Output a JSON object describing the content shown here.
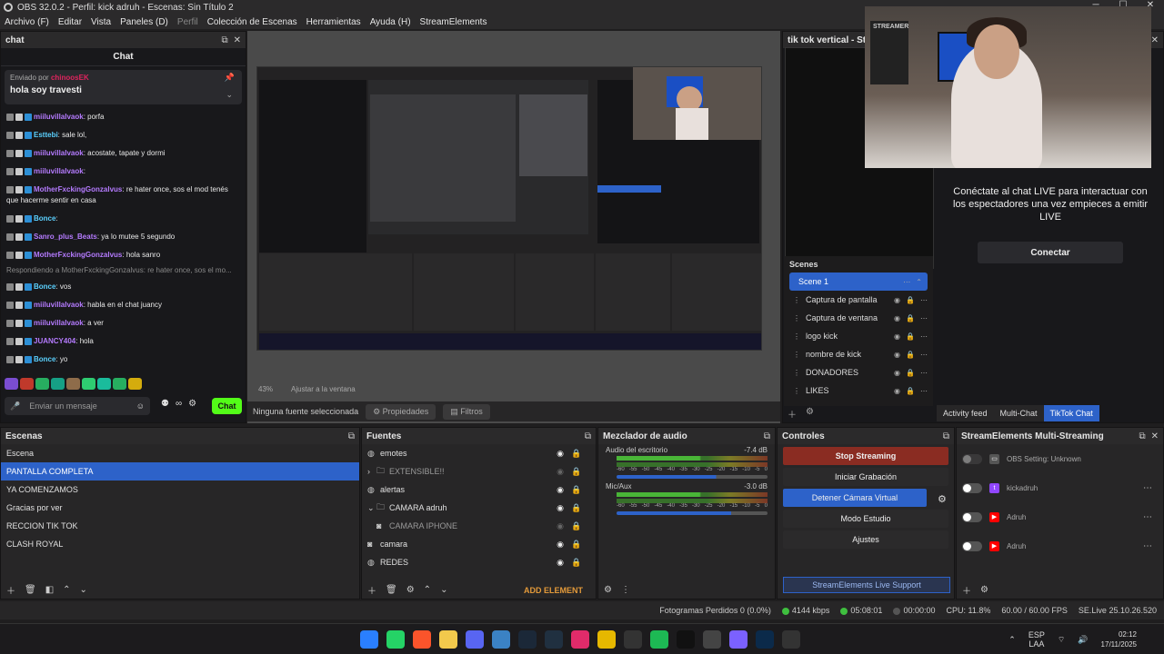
{
  "window": {
    "title": "OBS 32.0.2 - Perfil: kick adruh - Escenas: Sin Título 2"
  },
  "menu": [
    "Archivo (F)",
    "Editar",
    "Vista",
    "Paneles (D)",
    "Perfil",
    "Colección de Escenas",
    "Herramientas",
    "Ayuda (H)",
    "StreamElements"
  ],
  "chat": {
    "dock_title": "chat",
    "header": "Chat",
    "pinned_label": "Enviado por",
    "pinned_user": "chinoosEK",
    "pinned_message": "hola soy travesti",
    "messages": [
      {
        "user": "miiluvillalvaok",
        "text": "porfa",
        "color": "#b57bff"
      },
      {
        "user": "Esttebi",
        "text": "sale lol,",
        "color": "#5bd1ff"
      },
      {
        "user": "miiluvillalvaok",
        "text": "acostate, tapate y dormi",
        "color": "#b57bff"
      },
      {
        "user": "miiluvillalvaok",
        "text": "",
        "color": "#b57bff"
      },
      {
        "user": "MotherFxckingGonzalvus",
        "text": "re hater once, sos el mod tenés que hacerme sentir en casa",
        "color": "#b57bff"
      },
      {
        "user": "Bonce",
        "text": "",
        "color": "#5bd1ff"
      },
      {
        "user": "Sanro_plus_Beats",
        "text": "ya lo mutee 5 segundo",
        "color": "#b57bff"
      },
      {
        "user": "MotherFxckingGonzalvus",
        "text": "hola sanro",
        "color": "#b57bff"
      },
      {
        "user": "Bonce",
        "text": "vos",
        "color": "#5bd1ff",
        "reply": "Respondiendo a MotherFxckingGonzalvus: re hater once, sos el mo..."
      },
      {
        "user": "miiluvillalvaok",
        "text": "habla en el chat juancy",
        "color": "#b57bff"
      },
      {
        "user": "miiluvillalvaok",
        "text": "a ver",
        "color": "#b57bff"
      },
      {
        "user": "JUANCY404",
        "text": "hola",
        "color": "#b57bff"
      },
      {
        "user": "Bonce",
        "text": "yo",
        "color": "#5bd1ff"
      }
    ],
    "input_placeholder": "Enviar un mensaje",
    "send_label": "Chat"
  },
  "preview": {
    "zoom": "43%",
    "fit_label": "Ajustar a la ventana"
  },
  "propbar": {
    "no_source": "Ninguna fuente seleccionada",
    "properties": "Propiedades",
    "filters": "Filtros"
  },
  "tiktok": {
    "title": "tik tok vertical - Stre",
    "message": "Conéctate al chat LIVE para interactuar con los espectadores una vez empieces a emitir LIVE",
    "connect": "Conectar",
    "scenes_label": "Scenes",
    "scenes": [
      "Scene 1"
    ],
    "sources": [
      "Captura de pantalla",
      "Captura de ventana",
      "logo kick",
      "nombre de kick",
      "DONADORES",
      "LIKES"
    ],
    "tabs": [
      "Activity feed",
      "Multi-Chat",
      "TikTok Chat"
    ],
    "active_tab": "TikTok Chat"
  },
  "scenes": {
    "title": "Escenas",
    "items": [
      "Escena",
      "PANTALLA COMPLETA",
      "YA COMENZAMOS",
      "Gracias por ver",
      "RECCION TIK TOK",
      "CLASH ROYAL"
    ],
    "selected": "PANTALLA COMPLETA"
  },
  "sources": {
    "title": "Fuentes",
    "items": [
      {
        "name": "emotes",
        "icon": "globe-icon",
        "dim": false
      },
      {
        "name": "EXTENSIBLE!!",
        "icon": "folder-icon",
        "dim": true
      },
      {
        "name": "alertas",
        "icon": "globe-icon",
        "dim": false
      },
      {
        "name": "CAMARA adruh",
        "icon": "folder-icon",
        "dim": false
      },
      {
        "name": "CAMARA IPHONE",
        "icon": "camera-icon",
        "dim": true
      },
      {
        "name": "camara",
        "icon": "camera-icon",
        "dim": false
      },
      {
        "name": "REDES",
        "icon": "globe-icon",
        "dim": false
      }
    ],
    "add_element": "ADD ELEMENT"
  },
  "mixer": {
    "title": "Mezclador de audio",
    "channels": [
      {
        "name": "Audio del escritorio",
        "db": "-7.4 dB",
        "level": 0.66
      },
      {
        "name": "Mic/Aux",
        "db": "-3.0 dB",
        "level": 0.76
      }
    ],
    "scale": [
      "-60",
      "-55",
      "-50",
      "-45",
      "-40",
      "-35",
      "-30",
      "-25",
      "-20",
      "-15",
      "-10",
      "-5",
      "0"
    ]
  },
  "controls": {
    "title": "Controles",
    "buttons": [
      "Stop Streaming",
      "Iniciar Grabación",
      "Detener Cámara Virtual",
      "Modo Estudio",
      "Ajustes"
    ],
    "support": "StreamElements Live Support"
  },
  "multistream": {
    "title": "StreamElements Multi-Streaming",
    "rows": [
      {
        "label": "OBS Setting: Unknown",
        "platform": ""
      },
      {
        "label": "kickadruh",
        "platform": "twitch"
      },
      {
        "label": "Adruh",
        "platform": "youtube"
      },
      {
        "label": "Adruh",
        "platform": "youtube"
      }
    ]
  },
  "status": {
    "dropped": "Fotogramas Perdidos 0 (0.0%)",
    "bitrate": "4144 kbps",
    "stream_time": "05:08:01",
    "rec_time": "00:00:00",
    "cpu": "CPU: 11.8%",
    "fps": "60.00 / 60.00 FPS",
    "version": "SE.Live 25.10.26.520"
  },
  "taskbar": {
    "lang": "ESP",
    "lang2": "LAA",
    "time": "02:12",
    "date": "17/11/2025"
  },
  "colors": {
    "accent": "#2d62c9",
    "stop": "#8a2c22",
    "kick": "#53fc18"
  }
}
